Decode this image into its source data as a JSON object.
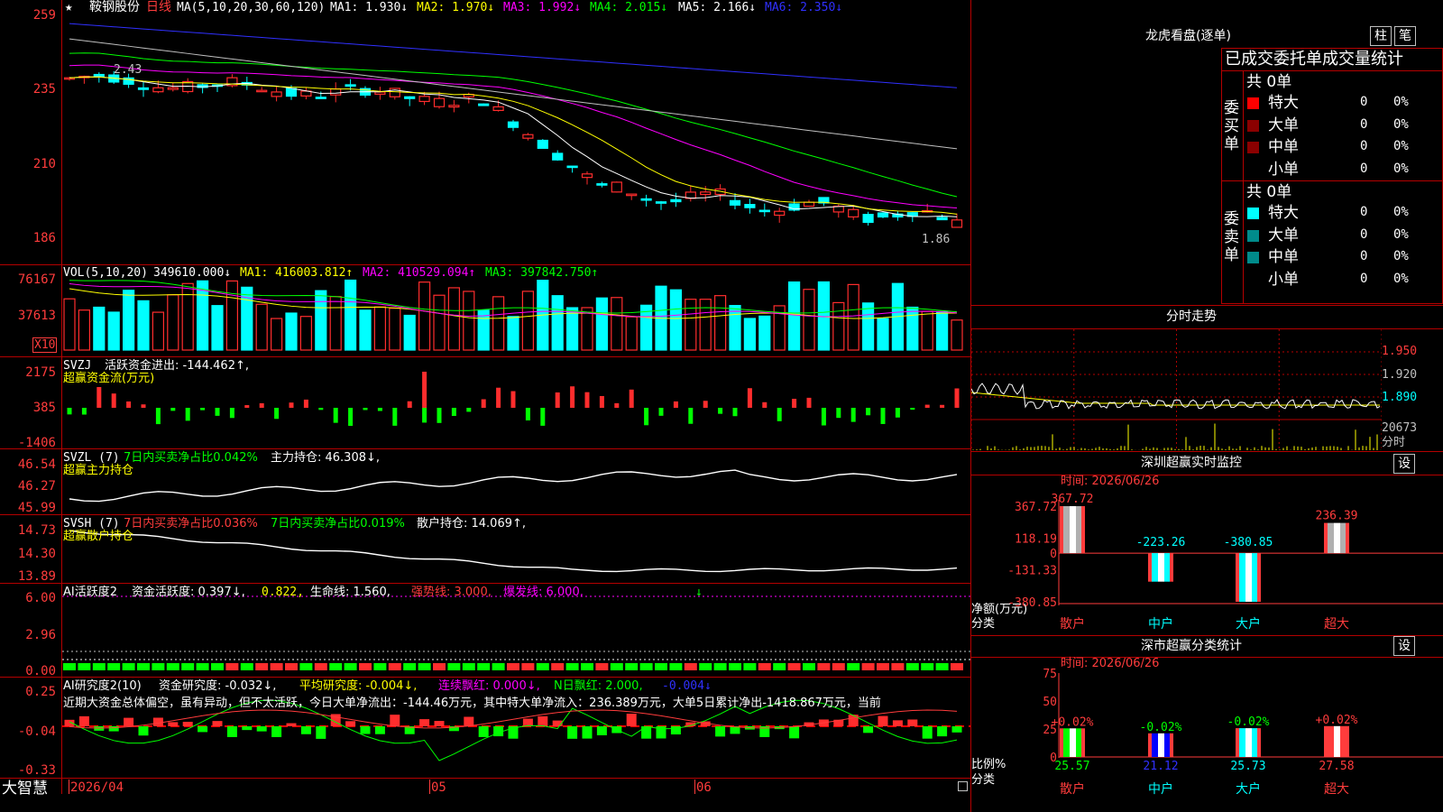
{
  "stock": {
    "name": "鞍钢股份",
    "period": "日线",
    "star": "★"
  },
  "colors": {
    "bg": "#000000",
    "grid_red": "#b40000",
    "up_red": "#ff2d2d",
    "down_cyan": "#00ffff",
    "ma1": "#ffffff",
    "ma2": "#ffff00",
    "ma3": "#ff00ff",
    "ma4": "#00ff00",
    "ma5": "#c0c0c0",
    "ma6": "#3030ff",
    "green": "#00ff00"
  },
  "price_panel": {
    "ma_label": "MA(5,10,20,30,60,120)",
    "ma1": "MA1: 1.930↓",
    "ma2": "MA2: 1.970↓",
    "ma3": "MA3: 1.992↓",
    "ma4": "MA4: 2.015↓",
    "ma5": "MA5: 2.166↓",
    "ma6": "MA6: 2.350↓",
    "axis": [
      "259",
      "235",
      "210",
      "186"
    ],
    "high_mark": "2.43",
    "low_mark": "1.86"
  },
  "vol_panel": {
    "label": "VOL(5,10,20)",
    "value": "349610.000↓",
    "ma1": "MA1: 416003.812↑",
    "ma2": "MA2: 410529.094↑",
    "ma3": "MA3: 397842.750↑",
    "axis": [
      "76167",
      "37613"
    ],
    "unit": "X10"
  },
  "svzj_panel": {
    "label": "SVZJ",
    "text": "活跃资金进出: -144.462↑,",
    "sub": "超赢资金流(万元)",
    "axis": [
      "2175",
      "385",
      "-1406"
    ]
  },
  "svzl_panel": {
    "label": "SVZL (7)",
    "text1": "7日内买卖净占比0.042%",
    "text2": "主力持仓: 46.308↓,",
    "sub": "超赢主力持仓",
    "axis": [
      "46.54",
      "46.27",
      "45.99"
    ]
  },
  "svsh_panel": {
    "label": "SVSH (7)",
    "text1": "7日内买卖净占比0.036%",
    "text2": "7日内买卖净占比0.019%",
    "text3": "散户持仓: 14.069↑,",
    "sub": "超赢散户持仓",
    "axis": [
      "14.73",
      "14.30",
      "13.89"
    ]
  },
  "ai_active_panel": {
    "label": "AI活跃度2",
    "text1": "资金活跃度: 0.397↓,",
    "text2": "0.822,",
    "text3": "生命线: 1.560,",
    "text4": "强势线: 3.000,",
    "text5": "爆发线: 6.000,",
    "axis": [
      "6.00",
      "2.96",
      "0.00"
    ]
  },
  "ai_research_panel": {
    "label": "AI研究度2(10)",
    "text1": "资金研究度: -0.032↓,",
    "text2": "平均研究度: -0.004↓,",
    "text3": "连续飘红: 0.000↓,",
    "text4": "N日飘红: 2.000,",
    "text5": "-0.004↓",
    "commentary": "近期大资金总体偏空，虽有异动，但不太活跃，今日大单净流出：-144.46万元，其中特大单净流入：236.389万元，大单5日累计净出-1418.867万元，当前",
    "axis": [
      "0.25",
      "-0.04",
      "-0.33"
    ]
  },
  "bottom_bar": {
    "brand": "大智慧",
    "dates": [
      "2026/04",
      "05",
      "06"
    ]
  },
  "right_panel": {
    "dragon_title": "龙虎看盘(逐单)",
    "btn_zhu": "柱",
    "btn_bi": "笔",
    "stats_title": "已成交委托单成交量统计",
    "buy_label": [
      "委",
      "买",
      "单"
    ],
    "sell_label": [
      "委",
      "卖",
      "单"
    ],
    "buy_total": "共 0单",
    "sell_total": "共 0单",
    "rows": [
      {
        "label": "特大",
        "count": "0",
        "pct": "0%"
      },
      {
        "label": "大单",
        "count": "0",
        "pct": "0%"
      },
      {
        "label": "中单",
        "count": "0",
        "pct": "0%"
      },
      {
        "label": "小单",
        "count": "0",
        "pct": "0%"
      }
    ],
    "fenshi_title": "分时走势",
    "fenshi_axis": [
      "1.950",
      "1.920",
      "1.890",
      "20673",
      "分时"
    ],
    "sz_monitor_title": "深圳超赢实时监控",
    "sz_monitor_btn": "设",
    "sz_monitor_time": "时间: 2026/06/26",
    "sz_monitor_axis": [
      "367.72",
      "118.19",
      "0",
      "-131.33",
      "-380.85"
    ],
    "sz_monitor_values": [
      367.72,
      -223.26,
      -380.85,
      236.39
    ],
    "sz_monitor_labels": [
      "367.72",
      "-223.26",
      "-380.85",
      "236.39"
    ],
    "sz_monitor_ylabel": [
      "净额(万元)",
      "分类"
    ],
    "categories": [
      "散户",
      "中户",
      "大户",
      "超大"
    ],
    "sz_stat_title": "深市超赢分类统计",
    "sz_stat_btn": "设",
    "sz_stat_time": "时间: 2026/06/26",
    "sz_stat_axis": [
      "75",
      "50",
      "25",
      "0"
    ],
    "sz_stat_values": [
      25.57,
      21.12,
      25.73,
      27.58
    ],
    "sz_stat_top": [
      "+0.02%",
      "-0.02%",
      "-0.02%",
      "+0.02%"
    ],
    "sz_stat_bottom": [
      "25.57",
      "21.12",
      "25.73",
      "27.58"
    ],
    "sz_stat_ylabel": [
      "比例%",
      "分类"
    ]
  }
}
